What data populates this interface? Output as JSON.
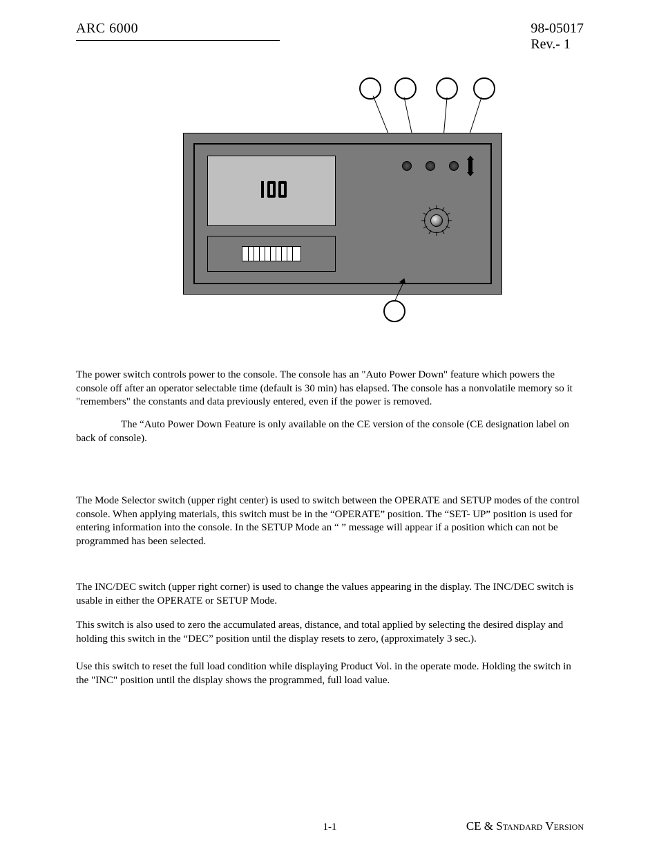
{
  "header": {
    "left": "ARC 6000",
    "doc_number": "98-05017",
    "revision": "Rev.- 1"
  },
  "console": {
    "display_value": "100"
  },
  "body": {
    "p1": "The power switch controls power to the console. The console has an \"Auto Power Down\" feature which powers the console off after an operator selectable time (default is 30 min) has elapsed. The console has a nonvolatile memory so it \"remembers\" the constants and data previously entered, even if the power is removed.",
    "p2": "The “Auto Power Down Feature is only available on the CE version of the console (CE designation label on back of console).",
    "p3": "The Mode Selector switch (upper right center) is used to switch between the OPERATE and SETUP modes of the control console.  When applying materials, this switch must be in the “OPERATE” position.  The “SET- UP” position is used for entering information into the console.  In the SETUP Mode an “      ” message will appear if a position which can not be programmed has been selected.",
    "p4": "The INC/DEC switch (upper right corner) is used to change the values appearing in the display.  The INC/DEC switch is usable in either the OPERATE or SETUP Mode.",
    "p5": "This switch is also used to zero the accumulated areas, distance, and total applied by selecting the desired display and holding this switch in the “DEC” position until the display resets to zero, (approximately 3 sec.).",
    "p6": "Use this switch to reset the full load condition while displaying Product Vol. in the operate mode.  Holding the switch in the \"INC\" position until the display shows the programmed, full load value."
  },
  "footer": {
    "page": "1-1",
    "version": "CE & Standard Version"
  }
}
